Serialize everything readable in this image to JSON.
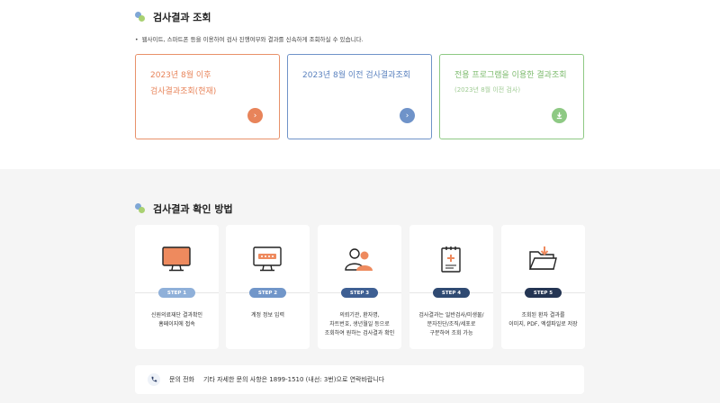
{
  "section1": {
    "title": "검사결과 조회",
    "description": "웹사이트, 스마트폰 등을 이용하여 검사 진행여부와 결과를 신속하게 조회하실 수 있습니다."
  },
  "cards": [
    {
      "line1": "2023년 8월 이후",
      "line2": "검사결과조회(현재)",
      "icon": "chevron-right-icon"
    },
    {
      "line1": "2023년 8월 이전 검사결과조회",
      "icon": "chevron-right-icon"
    },
    {
      "line1": "전용 프로그램을 이용한 결과조회",
      "sub": "(2023년 8월 이전 검사)",
      "icon": "download-icon"
    }
  ],
  "section2": {
    "title": "검사결과 확인 방법"
  },
  "steps": [
    {
      "badge": "STEP 1",
      "color": "#8fb0d9",
      "line1": "신원의료재단 결과확인",
      "line2": "홈페이지에 접속",
      "icon": "monitor-icon"
    },
    {
      "badge": "STEP 2",
      "color": "#7196c9",
      "line1": "계정 정보 입력",
      "icon": "password-monitor-icon"
    },
    {
      "badge": "STEP 3",
      "color": "#3e5f93",
      "line1": "의뢰기관, 환자명,",
      "line2": "차트번호, 생년월일 등으로",
      "line3": "조회하여 원하는 검사결과 확인",
      "icon": "users-icon"
    },
    {
      "badge": "STEP 4",
      "color": "#2f4a72",
      "line1": "검사결과는 일반검사/미생물/",
      "line2": "분자진단/조직/세포로",
      "line3": "구분하여 조회 가능",
      "icon": "clipboard-icon"
    },
    {
      "badge": "STEP 5",
      "color": "#243553",
      "line1": "조회된 환자 결과를",
      "line2": "이미지, PDF, 엑셀파일로 저장",
      "icon": "folder-download-icon"
    }
  ],
  "contact": {
    "label": "문의 전화",
    "text": "기타 자세한 문의 사항은 1899-1510 (내선: 3번)으로 연락바랍니다",
    "icon": "phone-icon"
  }
}
